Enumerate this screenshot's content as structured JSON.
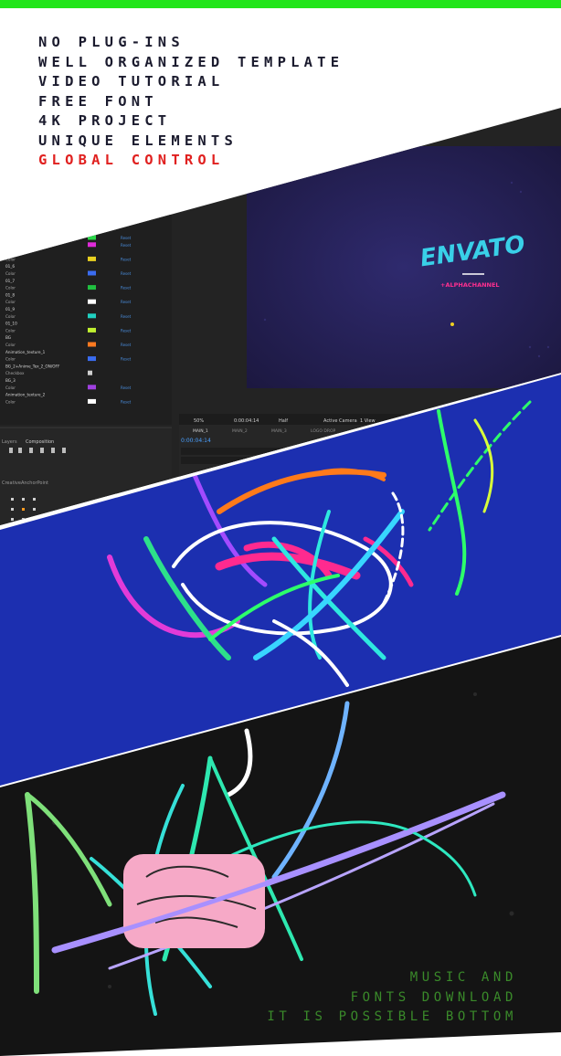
{
  "features": [
    "NO PLUG-INS",
    "WELL ORGANIZED TEMPLATE",
    "VIDEO TUTORIAL",
    "FREE FONT",
    "4K PROJECT",
    "UNIQUE ELEMENTS",
    "GLOBAL CONTROL"
  ],
  "features_highlight_color": "#e0201f",
  "accent_bar_color": "#22e51a",
  "editor": {
    "comp_logo_text": "ENVATO",
    "comp_sub_text": "+ALPHACHANNEL",
    "zoom": "50%",
    "timecode": "0:00:04:14",
    "resolution": "Half",
    "camera": "Active Camera",
    "view": "1 View",
    "tabs": [
      "MAIN_1",
      "MAIN_2",
      "MAIN_3",
      "LOGO DROP"
    ],
    "layers_label": "Layers",
    "layers_mode": "Composition",
    "anchor_label": "CreativeAnchorPoint",
    "layer_rows": [
      "Color",
      "Color",
      "01_5",
      "Color",
      "01_6",
      "Color",
      "01_7",
      "Color",
      "01_8",
      "Color",
      "01_9",
      "Color",
      "01_10",
      "Color",
      "BG",
      "Color",
      "Animation_texture_1",
      "Color",
      "BG_2+Anime_Tex_2_ON/OFF",
      "Checkbox",
      "BG_3",
      "Color",
      "Animation_texture_2",
      "Color"
    ],
    "reset_label": "Reset",
    "swatch_colors": [
      "#2bd94a",
      "#e02bd9",
      "#e8d020",
      "#3a6cf0",
      "#20c040",
      "#ffffff",
      "#20d0c0",
      "#c0f030",
      "#ff7a20",
      "#3a6cf0",
      "#a040e0",
      "#ffffff",
      "#1a1a40",
      "#8a40c0"
    ]
  },
  "bottom_note": [
    "MUSIC AND",
    "FONTS DOWNLOAD",
    "IT IS POSSIBLE BOTTOM"
  ],
  "bottom_note_color": "#3a8a2a"
}
